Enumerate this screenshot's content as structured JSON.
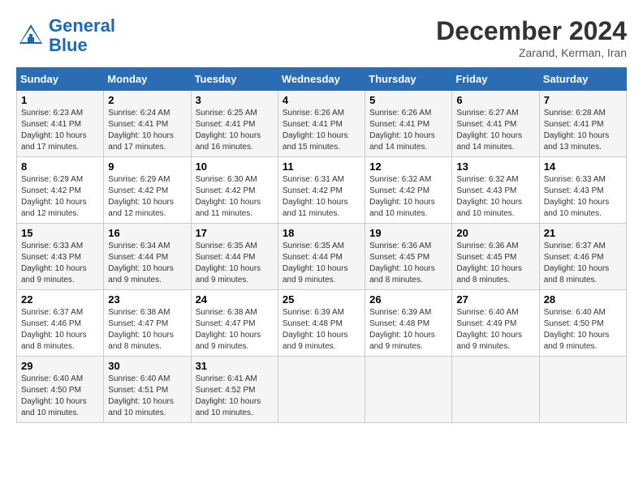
{
  "header": {
    "logo_line1": "General",
    "logo_line2": "Blue",
    "month_title": "December 2024",
    "location": "Zarand, Kerman, Iran"
  },
  "weekdays": [
    "Sunday",
    "Monday",
    "Tuesday",
    "Wednesday",
    "Thursday",
    "Friday",
    "Saturday"
  ],
  "weeks": [
    [
      {
        "day": "1",
        "info": "Sunrise: 6:23 AM\nSunset: 4:41 PM\nDaylight: 10 hours\nand 17 minutes."
      },
      {
        "day": "2",
        "info": "Sunrise: 6:24 AM\nSunset: 4:41 PM\nDaylight: 10 hours\nand 17 minutes."
      },
      {
        "day": "3",
        "info": "Sunrise: 6:25 AM\nSunset: 4:41 PM\nDaylight: 10 hours\nand 16 minutes."
      },
      {
        "day": "4",
        "info": "Sunrise: 6:26 AM\nSunset: 4:41 PM\nDaylight: 10 hours\nand 15 minutes."
      },
      {
        "day": "5",
        "info": "Sunrise: 6:26 AM\nSunset: 4:41 PM\nDaylight: 10 hours\nand 14 minutes."
      },
      {
        "day": "6",
        "info": "Sunrise: 6:27 AM\nSunset: 4:41 PM\nDaylight: 10 hours\nand 14 minutes."
      },
      {
        "day": "7",
        "info": "Sunrise: 6:28 AM\nSunset: 4:41 PM\nDaylight: 10 hours\nand 13 minutes."
      }
    ],
    [
      {
        "day": "8",
        "info": "Sunrise: 6:29 AM\nSunset: 4:42 PM\nDaylight: 10 hours\nand 12 minutes."
      },
      {
        "day": "9",
        "info": "Sunrise: 6:29 AM\nSunset: 4:42 PM\nDaylight: 10 hours\nand 12 minutes."
      },
      {
        "day": "10",
        "info": "Sunrise: 6:30 AM\nSunset: 4:42 PM\nDaylight: 10 hours\nand 11 minutes."
      },
      {
        "day": "11",
        "info": "Sunrise: 6:31 AM\nSunset: 4:42 PM\nDaylight: 10 hours\nand 11 minutes."
      },
      {
        "day": "12",
        "info": "Sunrise: 6:32 AM\nSunset: 4:42 PM\nDaylight: 10 hours\nand 10 minutes."
      },
      {
        "day": "13",
        "info": "Sunrise: 6:32 AM\nSunset: 4:43 PM\nDaylight: 10 hours\nand 10 minutes."
      },
      {
        "day": "14",
        "info": "Sunrise: 6:33 AM\nSunset: 4:43 PM\nDaylight: 10 hours\nand 10 minutes."
      }
    ],
    [
      {
        "day": "15",
        "info": "Sunrise: 6:33 AM\nSunset: 4:43 PM\nDaylight: 10 hours\nand 9 minutes."
      },
      {
        "day": "16",
        "info": "Sunrise: 6:34 AM\nSunset: 4:44 PM\nDaylight: 10 hours\nand 9 minutes."
      },
      {
        "day": "17",
        "info": "Sunrise: 6:35 AM\nSunset: 4:44 PM\nDaylight: 10 hours\nand 9 minutes."
      },
      {
        "day": "18",
        "info": "Sunrise: 6:35 AM\nSunset: 4:44 PM\nDaylight: 10 hours\nand 9 minutes."
      },
      {
        "day": "19",
        "info": "Sunrise: 6:36 AM\nSunset: 4:45 PM\nDaylight: 10 hours\nand 8 minutes."
      },
      {
        "day": "20",
        "info": "Sunrise: 6:36 AM\nSunset: 4:45 PM\nDaylight: 10 hours\nand 8 minutes."
      },
      {
        "day": "21",
        "info": "Sunrise: 6:37 AM\nSunset: 4:46 PM\nDaylight: 10 hours\nand 8 minutes."
      }
    ],
    [
      {
        "day": "22",
        "info": "Sunrise: 6:37 AM\nSunset: 4:46 PM\nDaylight: 10 hours\nand 8 minutes."
      },
      {
        "day": "23",
        "info": "Sunrise: 6:38 AM\nSunset: 4:47 PM\nDaylight: 10 hours\nand 8 minutes."
      },
      {
        "day": "24",
        "info": "Sunrise: 6:38 AM\nSunset: 4:47 PM\nDaylight: 10 hours\nand 9 minutes."
      },
      {
        "day": "25",
        "info": "Sunrise: 6:39 AM\nSunset: 4:48 PM\nDaylight: 10 hours\nand 9 minutes."
      },
      {
        "day": "26",
        "info": "Sunrise: 6:39 AM\nSunset: 4:48 PM\nDaylight: 10 hours\nand 9 minutes."
      },
      {
        "day": "27",
        "info": "Sunrise: 6:40 AM\nSunset: 4:49 PM\nDaylight: 10 hours\nand 9 minutes."
      },
      {
        "day": "28",
        "info": "Sunrise: 6:40 AM\nSunset: 4:50 PM\nDaylight: 10 hours\nand 9 minutes."
      }
    ],
    [
      {
        "day": "29",
        "info": "Sunrise: 6:40 AM\nSunset: 4:50 PM\nDaylight: 10 hours\nand 10 minutes."
      },
      {
        "day": "30",
        "info": "Sunrise: 6:40 AM\nSunset: 4:51 PM\nDaylight: 10 hours\nand 10 minutes."
      },
      {
        "day": "31",
        "info": "Sunrise: 6:41 AM\nSunset: 4:52 PM\nDaylight: 10 hours\nand 10 minutes."
      },
      {
        "day": "",
        "info": ""
      },
      {
        "day": "",
        "info": ""
      },
      {
        "day": "",
        "info": ""
      },
      {
        "day": "",
        "info": ""
      }
    ]
  ]
}
